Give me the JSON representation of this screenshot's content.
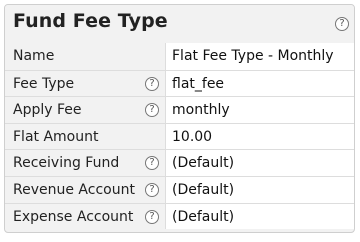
{
  "panel": {
    "title": "Fund Fee Type",
    "help_icon": "question-circle-icon"
  },
  "rows": [
    {
      "label": "Name",
      "value": "Flat Fee Type - Monthly",
      "has_help": false
    },
    {
      "label": "Fee Type",
      "value": "flat_fee",
      "has_help": true
    },
    {
      "label": "Apply Fee",
      "value": "monthly",
      "has_help": true
    },
    {
      "label": "Flat Amount",
      "value": "10.00",
      "has_help": false
    },
    {
      "label": "Receiving Fund",
      "value": "(Default)",
      "has_help": true
    },
    {
      "label": "Revenue Account",
      "value": "(Default)",
      "has_help": true
    },
    {
      "label": "Expense Account",
      "value": "(Default)",
      "has_help": true
    }
  ],
  "help_glyph": "?",
  "colors": {
    "label_bg": "#f2f2f2",
    "value_bg": "#ffffff",
    "border": "#cfcfcf"
  }
}
